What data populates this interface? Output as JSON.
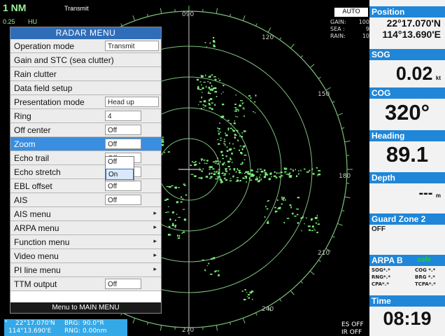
{
  "header": {
    "range": "1 NM",
    "mode": "Transmit",
    "range_small": "0.25",
    "presentation_abbr": "HU"
  },
  "radar": {
    "bearings": [
      "090",
      "120",
      "150",
      "180",
      "210",
      "240",
      "270"
    ],
    "auto_label": "AUTO",
    "gain": {
      "label": "GAIN:",
      "value": "100"
    },
    "sea": {
      "label": "SEA :",
      "value": "9"
    },
    "rain": {
      "label": "RAIN:",
      "value": "10"
    },
    "es_status": "ES OFF",
    "ir_status": "IR OFF"
  },
  "menu": {
    "title": "RADAR MENU",
    "items": [
      {
        "label": "Operation mode",
        "value": "Transmit"
      },
      {
        "label": "Gain and STC (sea clutter)"
      },
      {
        "label": "Rain clutter"
      },
      {
        "label": "Data field setup"
      },
      {
        "label": "Presentation mode",
        "value": "Head up"
      },
      {
        "label": "Ring",
        "value": "4"
      },
      {
        "label": "Off center",
        "value": "Off"
      },
      {
        "label": "Zoom",
        "value": "Off"
      },
      {
        "label": "Echo trail",
        "value": "Off"
      },
      {
        "label": "Echo stretch",
        "value": "Off"
      },
      {
        "label": "EBL offset",
        "value": "Off"
      },
      {
        "label": "AIS",
        "value": "Off"
      },
      {
        "label": "AIS menu",
        "arrow": "▸"
      },
      {
        "label": "ARPA menu",
        "arrow": "▸"
      },
      {
        "label": "Function menu",
        "arrow": "▸"
      },
      {
        "label": "Video menu",
        "arrow": "▸"
      },
      {
        "label": "PI line menu",
        "arrow": "▸"
      },
      {
        "label": "TTM output",
        "value": "Off"
      }
    ],
    "footer": "Menu to MAIN MENU",
    "dropdown": {
      "options": [
        "Off",
        "On"
      ],
      "highlighted": "On"
    }
  },
  "cursor": {
    "lat": "22°17.070'N",
    "lon": "114°13.690'E",
    "brg_label": "BRG:",
    "brg_value": "90.0°R",
    "rng_label": "RNG:",
    "rng_value": "0.00nm"
  },
  "panel": {
    "position": {
      "label": "Position",
      "lat": "22°17.070'N",
      "lon": "114°13.690'E"
    },
    "sog": {
      "label": "SOG",
      "value": "0.02",
      "unit": "kt"
    },
    "cog": {
      "label": "COG",
      "value": "320°"
    },
    "heading": {
      "label": "Heading",
      "value": "89.1"
    },
    "depth": {
      "label": "Depth",
      "value": "---",
      "unit": "m"
    },
    "guard_zone": {
      "label": "Guard Zone 2",
      "value": "OFF"
    },
    "arpa": {
      "label": "ARPA B",
      "status": "safe",
      "rows": [
        {
          "k1": "SOG",
          "v1": "*.*",
          "k2": "COG",
          "v2": "*.*"
        },
        {
          "k1": "RNG",
          "v1": "*.*",
          "k2": "BRG",
          "v2": "*.*"
        },
        {
          "k1": "CPA",
          "v1": "*.*",
          "k2": "TCPA",
          "v2": "*.*"
        }
      ]
    },
    "time": {
      "label": "Time",
      "value": "08:19"
    }
  },
  "colors": {
    "echo": "#7cf07c",
    "ring": "#7cc07c",
    "panel_header": "#1f86d8",
    "menu_title": "#2f6db8",
    "menu_selected": "#3a8ee0",
    "arpa_safe": "#1bd21b"
  }
}
